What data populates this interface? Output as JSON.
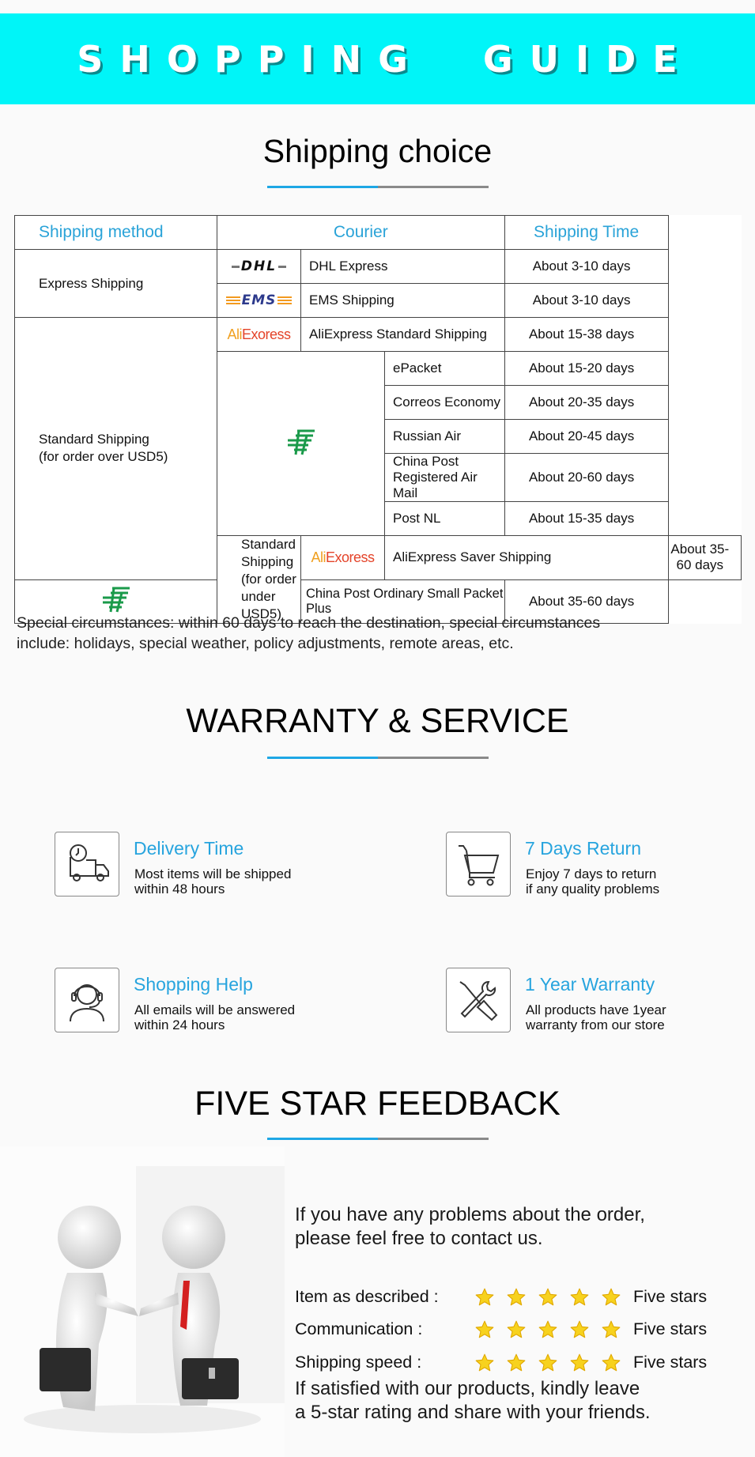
{
  "banner": {
    "title": "SHOPPING  GUIDE"
  },
  "shipping": {
    "title": "Shipping choice",
    "headers": {
      "method": "Shipping method",
      "courier": "Courier",
      "time": "Shipping Time"
    },
    "groups": [
      {
        "method": "Express Shipping",
        "rows": [
          {
            "logo": "DHL",
            "courier": "DHL Express",
            "time": "About 3-10 days"
          },
          {
            "logo": "EMS",
            "courier": "EMS Shipping",
            "time": "About 3-10 days"
          }
        ]
      },
      {
        "method_line1": "Standard Shipping",
        "method_line2": "(for order over USD5)",
        "rows": [
          {
            "logo": "AliExoress",
            "courier": "AliExpress Standard Shipping",
            "time": "About 15-38 days"
          },
          {
            "logo": "China Post",
            "courier": "ePacket",
            "time": "About 15-20 days"
          },
          {
            "logo": "China Post",
            "courier": "Correos Economy",
            "time": "About 20-35 days"
          },
          {
            "logo": "China Post",
            "courier": "Russian Air",
            "time": "About 20-45 days"
          },
          {
            "logo": "China Post",
            "courier": "China Post Registered Air Mail",
            "time": "About 20-60 days"
          },
          {
            "logo": "China Post",
            "courier": "Post NL",
            "time": "About 15-35 days"
          }
        ]
      },
      {
        "method_line1": "Standard Shipping",
        "method_line2": "(for order under USD5)",
        "rows": [
          {
            "logo": "AliExoress",
            "courier": "AliExpress Saver Shipping",
            "time": "About 35-60 days"
          },
          {
            "logo": "China Post",
            "courier": "China Post Ordinary Small Packet Plus",
            "time": "About 35-60 days"
          }
        ]
      }
    ],
    "logo_text": {
      "dhl": "DHL",
      "ems": "EMS",
      "ali_part1": "Ali",
      "ali_part2": "Exoress"
    },
    "note_line1": "Special circumstances: within 60 days to reach the destination, special circumstances",
    "note_line2": "include: holidays, special weather, policy adjustments, remote areas, etc."
  },
  "warranty": {
    "title": "WARRANTY & SERVICE",
    "items": [
      {
        "icon": "delivery-truck-clock-icon",
        "title": "Delivery Time",
        "line1": "Most items will be shipped",
        "line2": "within 48 hours"
      },
      {
        "icon": "shopping-cart-icon",
        "title": "7 Days Return",
        "line1": "Enjoy 7 days to return",
        "line2": "if any quality problems"
      },
      {
        "icon": "headset-support-icon",
        "title": "Shopping Help",
        "line1": "All emails will be answered",
        "line2": "within 24 hours"
      },
      {
        "icon": "tools-wrench-screwdriver-icon",
        "title": "1 Year Warranty",
        "line1": "All products have 1year",
        "line2": "warranty from our store"
      }
    ]
  },
  "feedback": {
    "title": "FIVE STAR FEEDBACK",
    "intro_line1": "If you have any problems about the order,",
    "intro_line2": "please feel free to contact us.",
    "ratings": [
      {
        "label": "Item as described :",
        "stars": 5,
        "value": "Five stars"
      },
      {
        "label": "Communication :",
        "stars": 5,
        "value": "Five stars"
      },
      {
        "label": "Shipping speed :",
        "stars": 5,
        "value": "Five stars"
      }
    ],
    "outro_line1": "If satisfied with our products, kindly leave",
    "outro_line2": "a 5-star rating and share with your friends."
  },
  "colors": {
    "banner": "#00f5f8",
    "accent_blue": "#27a4de",
    "divider_gray": "#8a8a8a",
    "star_yellow": "#f7d21e",
    "china_post_green": "#1a9a4a"
  }
}
